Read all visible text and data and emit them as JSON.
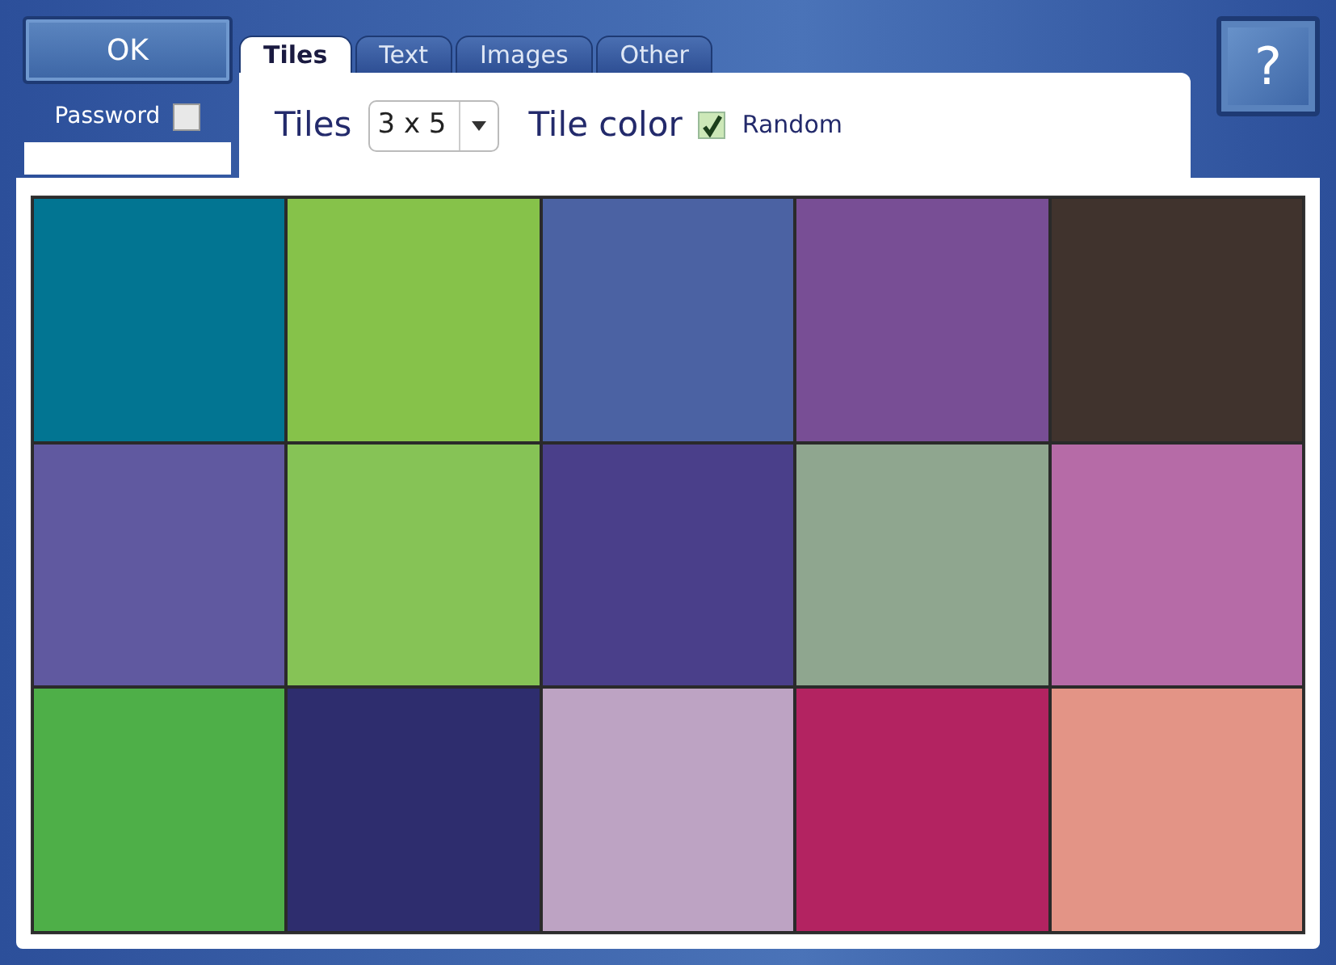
{
  "ok_button": {
    "label": "OK"
  },
  "password": {
    "label": "Password",
    "checked": false
  },
  "tabs": [
    {
      "label": "Tiles",
      "selected": true
    },
    {
      "label": "Text",
      "selected": false
    },
    {
      "label": "Images",
      "selected": false
    },
    {
      "label": "Other",
      "selected": false
    }
  ],
  "toolbar": {
    "tiles_label": "Tiles",
    "tiles_select": "3 x 5",
    "tile_color_label": "Tile color",
    "random": {
      "label": "Random",
      "checked": true
    }
  },
  "help_button": {
    "label": "?"
  },
  "tiles": [
    {
      "color": "#027592"
    },
    {
      "color": "#86c24a"
    },
    {
      "color": "#4b62a3"
    },
    {
      "color": "#784e95"
    },
    {
      "color": "#40332d"
    },
    {
      "color": "#6059a0"
    },
    {
      "color": "#86c356"
    },
    {
      "color": "#4a3f8a"
    },
    {
      "color": "#8fa68f"
    },
    {
      "color": "#b66ba7"
    },
    {
      "color": "#4eaf48"
    },
    {
      "color": "#2e2d6e"
    },
    {
      "color": "#bda3c3"
    },
    {
      "color": "#b32361"
    },
    {
      "color": "#e39486"
    }
  ]
}
